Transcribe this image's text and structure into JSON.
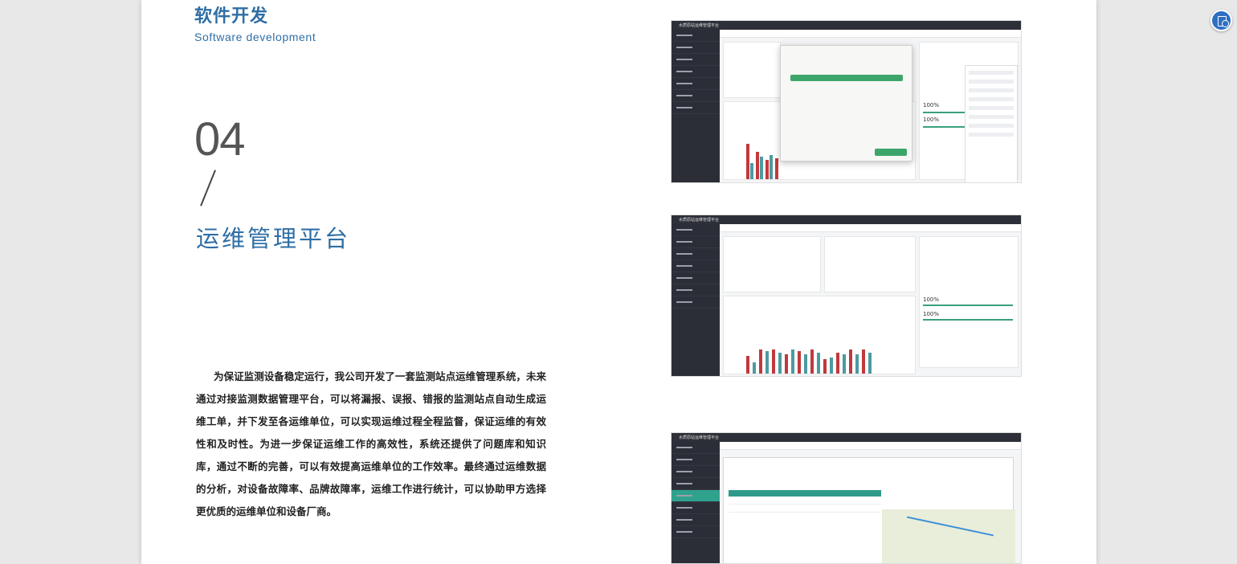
{
  "section": {
    "title": "软件开发",
    "subtitle": "Software development",
    "number": "04",
    "slash": "/",
    "platform_title": "运维管理平台"
  },
  "body_text": "为保证监测设备稳定运行，我公司开发了一套监测站点运维管理系统，未来通过对接监测数据管理平台，可以将漏报、误报、错报的监测站点自动生成运维工单，并下发至各运维单位，可以实现运维过程全程监督，保证运维的有效性和及时性。为进一步保证运维工作的高效性，系统还提供了问题库和知识库，通过不断的完善，可以有效提高运维单位的工作效率。最终通过运维数据的分析，对设备故障率、品牌故障率，运维工作进行统计，可以协助甲方选择更优质的运维单位和设备厂商。",
  "screenshots": {
    "app_name": "水质原站运维管理平台",
    "percent_a": "100%",
    "percent_b": "100%"
  },
  "colors": {
    "accent_blue": "#2f6ea5",
    "sidebar_dark": "#2b2e36",
    "bar_red": "#c0393b",
    "bar_teal": "#4d9aa0",
    "success_green": "#3ba56a"
  },
  "icons": {
    "corner_button": "reader-mode-icon"
  }
}
